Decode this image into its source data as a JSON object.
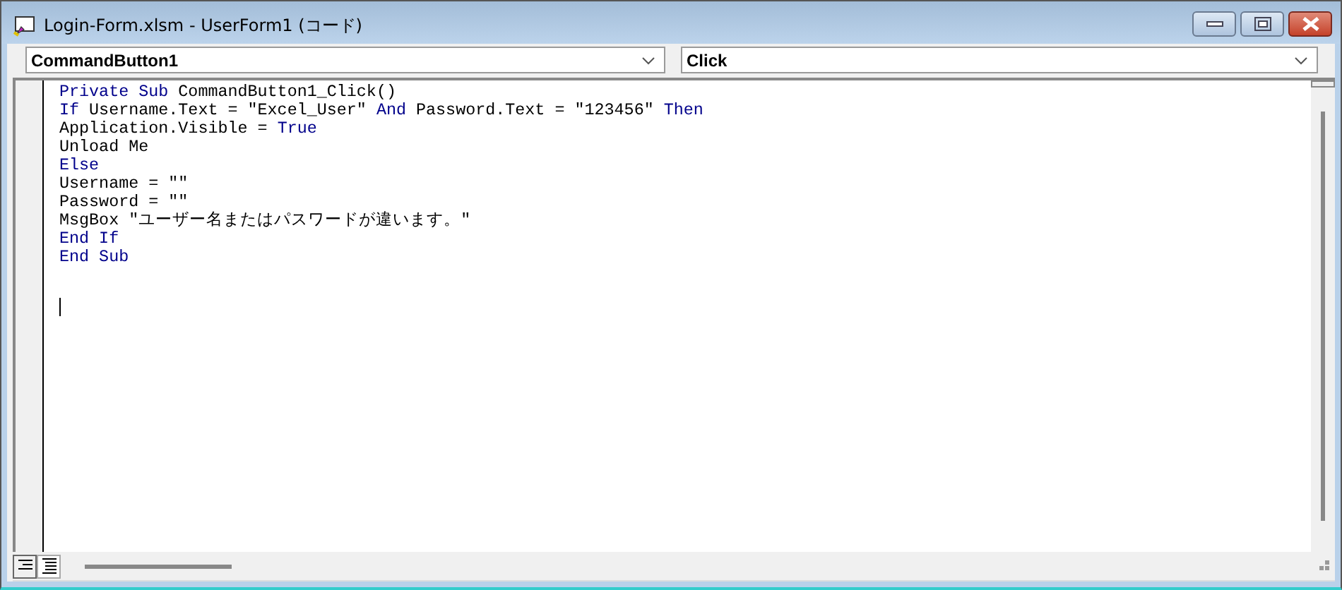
{
  "window": {
    "title": "Login-Form.xlsm - UserForm1 (コード)"
  },
  "object_dropdown": {
    "value": "CommandButton1"
  },
  "procedure_dropdown": {
    "value": "Click"
  },
  "code_lines": [
    {
      "segments": [
        {
          "kind": "keyword",
          "text": "Private Sub"
        },
        {
          "kind": "plain",
          "text": " CommandButton1_Click()"
        }
      ]
    },
    {
      "segments": [
        {
          "kind": "keyword",
          "text": "If"
        },
        {
          "kind": "plain",
          "text": " Username.Text = \"Excel_User\" "
        },
        {
          "kind": "keyword",
          "text": "And"
        },
        {
          "kind": "plain",
          "text": " Password.Text = \"123456\" "
        },
        {
          "kind": "keyword",
          "text": "Then"
        }
      ]
    },
    {
      "segments": [
        {
          "kind": "plain",
          "text": "Application.Visible = "
        },
        {
          "kind": "keyword",
          "text": "True"
        }
      ]
    },
    {
      "segments": [
        {
          "kind": "plain",
          "text": "Unload Me"
        }
      ]
    },
    {
      "segments": [
        {
          "kind": "keyword",
          "text": "Else"
        }
      ]
    },
    {
      "segments": [
        {
          "kind": "plain",
          "text": "Username = \"\""
        }
      ]
    },
    {
      "segments": [
        {
          "kind": "plain",
          "text": "Password = \"\""
        }
      ]
    },
    {
      "segments": [
        {
          "kind": "plain",
          "text": "MsgBox \"ユーザー名またはパスワードが違います。\""
        }
      ]
    },
    {
      "segments": [
        {
          "kind": "keyword",
          "text": "End If"
        }
      ]
    },
    {
      "segments": [
        {
          "kind": "keyword",
          "text": "End Sub"
        }
      ]
    }
  ]
}
